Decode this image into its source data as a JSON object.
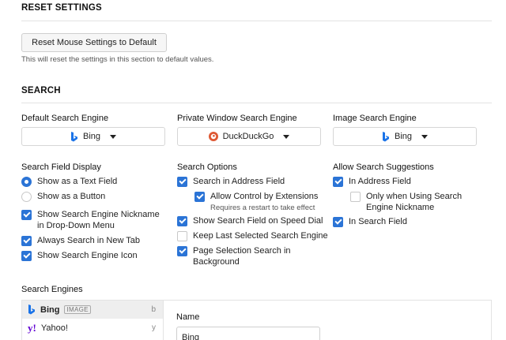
{
  "reset": {
    "title": "RESET SETTINGS",
    "button_label": "Reset Mouse Settings to Default",
    "note": "This will reset the settings in this section to default values."
  },
  "search": {
    "title": "SEARCH",
    "default_engine_label": "Default Search Engine",
    "default_engine_value": "Bing",
    "private_engine_label": "Private Window Search Engine",
    "private_engine_value": "DuckDuckGo",
    "image_engine_label": "Image Search Engine",
    "image_engine_value": "Bing",
    "field_display": {
      "label": "Search Field Display",
      "opt_text_field": "Show as a Text Field",
      "opt_button": "Show as a Button",
      "nickname": "Show Search Engine Nickname in Drop-Down Menu",
      "always_new_tab": "Always Search in New Tab",
      "engine_icon": "Show Search Engine Icon"
    },
    "options": {
      "label": "Search Options",
      "address_field": "Search in Address Field",
      "allow_extensions": "Allow Control by Extensions",
      "restart_note": "Requires a restart to take effect",
      "speed_dial": "Show Search Field on Speed Dial",
      "keep_last": "Keep Last Selected Search Engine",
      "page_selection": "Page Selection Search in Background"
    },
    "suggestions": {
      "label": "Allow Search Suggestions",
      "address_field": "In Address Field",
      "only_nickname": "Only when Using Search Engine Nickname",
      "search_field": "In Search Field"
    },
    "engines": {
      "label": "Search Engines",
      "items": [
        {
          "name": "Bing",
          "tag": "IMAGE",
          "key": "b"
        },
        {
          "name": "Yahoo!",
          "tag": "",
          "key": "y"
        }
      ],
      "detail_name_label": "Name",
      "detail_name_value": "Bing"
    }
  },
  "colors": {
    "accent": "#2b74d6",
    "bing": "#1a73e8",
    "duckduckgo": "#de5833",
    "yahoo": "#6001d2"
  }
}
